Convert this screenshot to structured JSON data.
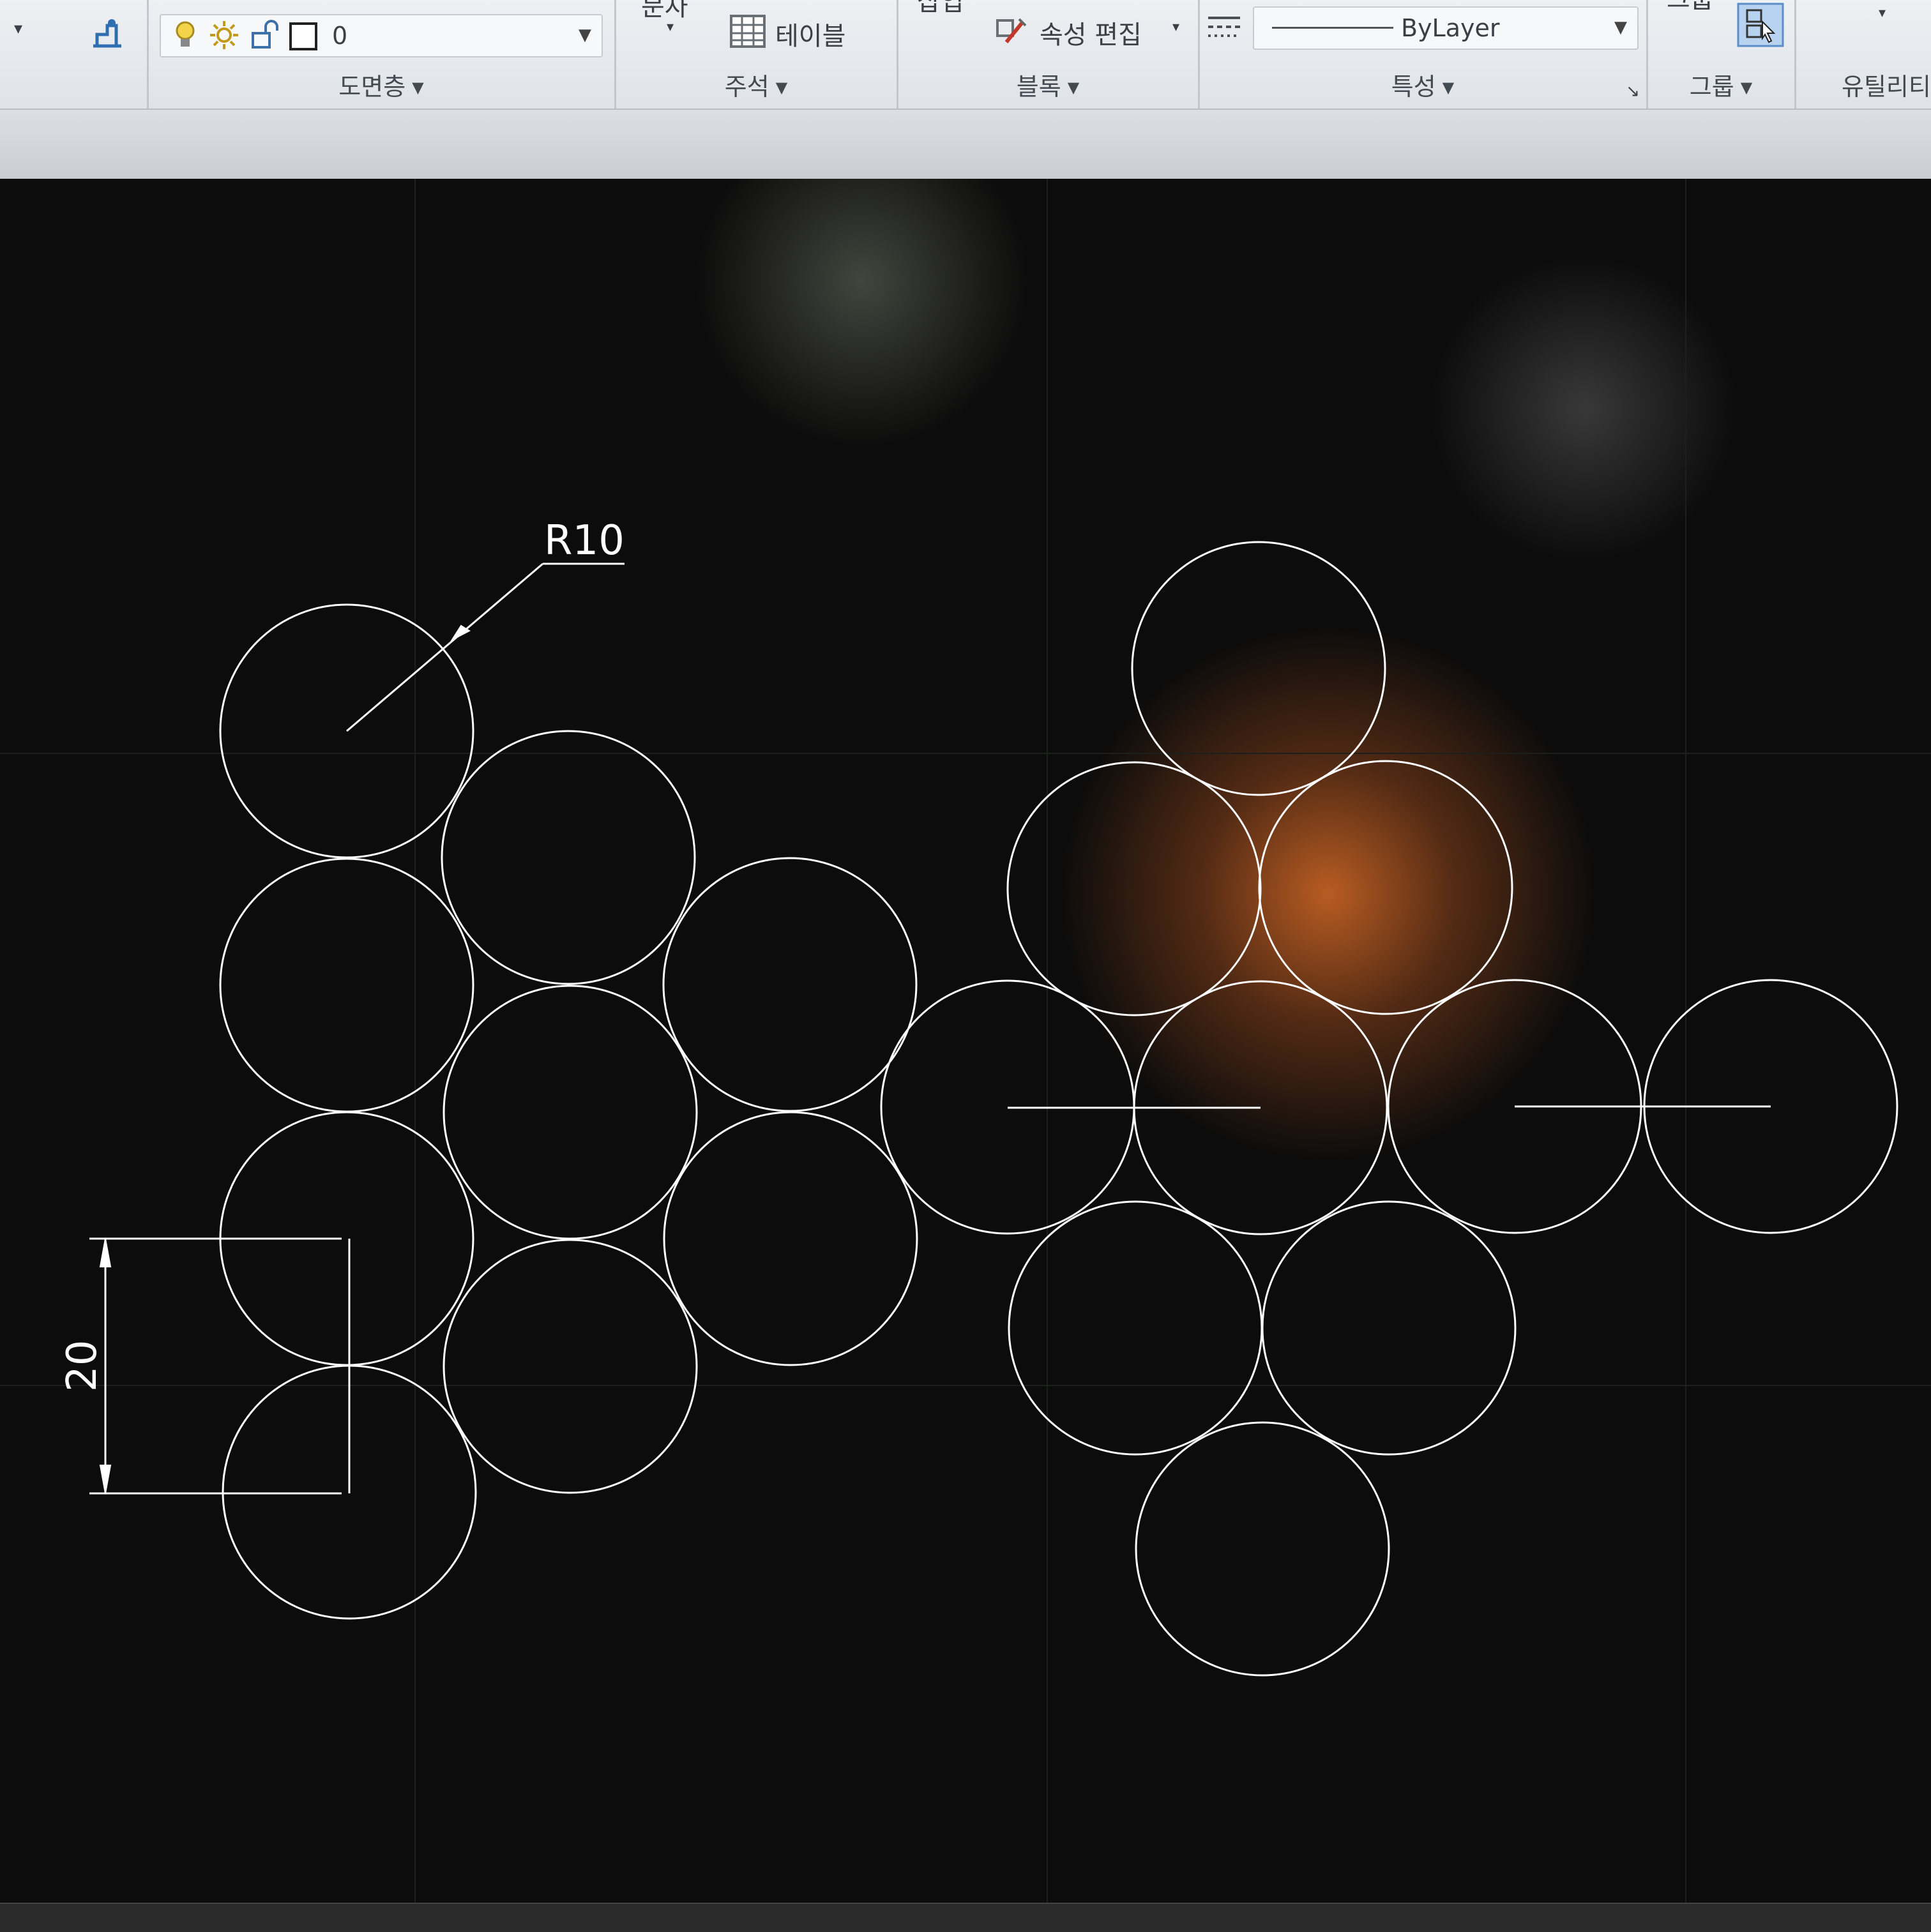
{
  "ribbon": {
    "layer_panel": {
      "title": "도면층",
      "current_layer": "0"
    },
    "annotation_panel": {
      "title": "주석",
      "top_item": "문자",
      "table_label": "테이블"
    },
    "block_panel": {
      "title": "블록",
      "top_item": "삽입",
      "attribute_edit_label": "속성 편집"
    },
    "properties_panel": {
      "title": "특성",
      "linetype_value": "ByLayer"
    },
    "group_panel": {
      "title": "그룹",
      "top_item": "그룹"
    },
    "utilities_panel": {
      "title": "유틸리티"
    }
  },
  "drawing": {
    "radius_dim_label": "R10",
    "linear_dim_label": "20",
    "colors": {
      "background": "#0c0c0c",
      "linework": "#ffffff",
      "glare": "#d66a26"
    }
  }
}
